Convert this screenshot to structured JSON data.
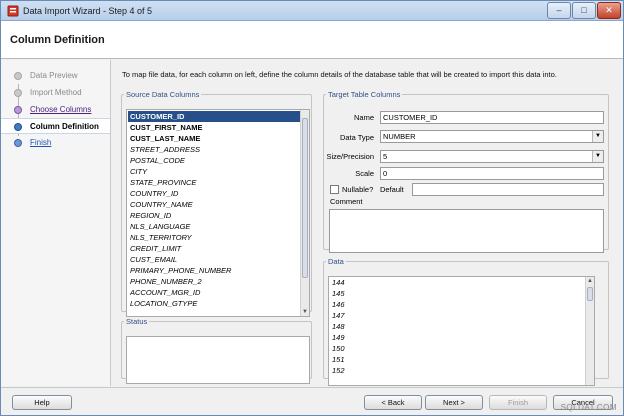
{
  "window": {
    "title": "Data Import Wizard - Step 4 of 5",
    "controls": {
      "minimize": "–",
      "maximize": "□",
      "close": "✕"
    }
  },
  "header": {
    "title": "Column Definition"
  },
  "steps": [
    {
      "label": "Data Preview",
      "state": "done"
    },
    {
      "label": "Import Method",
      "state": "done"
    },
    {
      "label": "Choose Columns",
      "state": "link"
    },
    {
      "label": "Column Definition",
      "state": "current"
    },
    {
      "label": "Finish",
      "state": "future"
    }
  ],
  "instruction": "To map file data, for each column on left, define the column details of the database table that will be created to import this data into.",
  "source": {
    "legend": "Source Data Columns",
    "columns": [
      {
        "name": "CUSTOMER_ID",
        "style": "bold",
        "selected": true
      },
      {
        "name": "CUST_FIRST_NAME",
        "style": "bold"
      },
      {
        "name": "CUST_LAST_NAME",
        "style": "bold"
      },
      {
        "name": "STREET_ADDRESS",
        "style": "italic"
      },
      {
        "name": "POSTAL_CODE",
        "style": "italic"
      },
      {
        "name": "CITY",
        "style": "italic"
      },
      {
        "name": "STATE_PROVINCE",
        "style": "italic"
      },
      {
        "name": "COUNTRY_ID",
        "style": "italic"
      },
      {
        "name": "COUNTRY_NAME",
        "style": "italic"
      },
      {
        "name": "REGION_ID",
        "style": "italic"
      },
      {
        "name": "NLS_LANGUAGE",
        "style": "italic"
      },
      {
        "name": "NLS_TERRITORY",
        "style": "italic"
      },
      {
        "name": "CREDIT_LIMIT",
        "style": "italic"
      },
      {
        "name": "CUST_EMAIL",
        "style": "italic"
      },
      {
        "name": "PRIMARY_PHONE_NUMBER",
        "style": "italic"
      },
      {
        "name": "PHONE_NUMBER_2",
        "style": "italic"
      },
      {
        "name": "ACCOUNT_MGR_ID",
        "style": "italic"
      },
      {
        "name": "LOCATION_GTYPE",
        "style": "italic"
      }
    ]
  },
  "status": {
    "legend": "Status"
  },
  "target": {
    "legend": "Target Table Columns",
    "name_label": "Name",
    "name_value": "CUSTOMER_ID",
    "datatype_label": "Data Type",
    "datatype_value": "NUMBER",
    "size_label": "Size/Precision",
    "size_value": "5",
    "scale_label": "Scale",
    "scale_value": "0",
    "nullable_label": "Nullable?",
    "nullable_checked": false,
    "default_label": "Default",
    "default_value": "",
    "comment_label": "Comment"
  },
  "data": {
    "legend": "Data",
    "rows": [
      "144",
      "145",
      "146",
      "147",
      "148",
      "149",
      "150",
      "151",
      "152"
    ]
  },
  "footer": {
    "help": "Help",
    "back": "< Back",
    "next": "Next >",
    "finish": "Finish",
    "cancel": "Cancel"
  },
  "watermark": "SQLDAT.COM"
}
